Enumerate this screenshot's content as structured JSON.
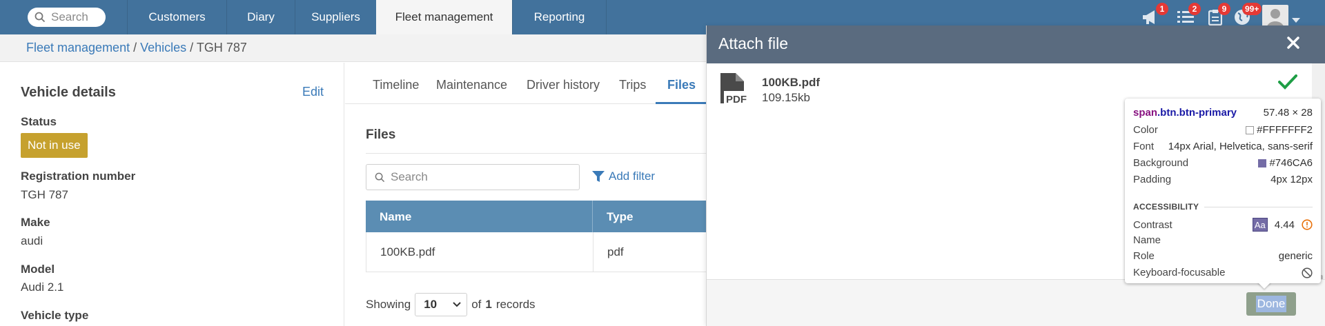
{
  "search": {
    "placeholder": "Search"
  },
  "nav": {
    "tabs": [
      {
        "label": "Customers"
      },
      {
        "label": "Diary"
      },
      {
        "label": "Suppliers"
      },
      {
        "label": "Fleet management"
      },
      {
        "label": "Reporting"
      }
    ],
    "active_tab": "Fleet management",
    "badges": {
      "announcements": "1",
      "tasks": "2",
      "clipboard": "9",
      "globe": "99+"
    }
  },
  "breadcrumb": {
    "level1": "Fleet management",
    "sep": " / ",
    "level2": "Vehicles",
    "current": "TGH 787"
  },
  "vehicle": {
    "title": "Vehicle details",
    "edit_label": "Edit",
    "status_label": "Status",
    "status_value": "Not in use",
    "reg_label": "Registration number",
    "reg_value": "TGH 787",
    "make_label": "Make",
    "make_value": "audi",
    "model_label": "Model",
    "model_value": "Audi 2.1",
    "type_label": "Vehicle type"
  },
  "tabs": [
    {
      "label": "Timeline"
    },
    {
      "label": "Maintenance"
    },
    {
      "label": "Driver history"
    },
    {
      "label": "Trips"
    },
    {
      "label": "Files"
    }
  ],
  "active_content_tab": "Files",
  "files": {
    "title": "Files",
    "search_placeholder": "Search",
    "add_filter": "Add filter",
    "columns": [
      "Name",
      "Type"
    ],
    "rows": [
      {
        "name": "100KB.pdf",
        "type": "pdf"
      }
    ],
    "showing_prefix": "Showing",
    "page_size": "10",
    "of_text": "of",
    "total": "1",
    "records_text": "records"
  },
  "modal": {
    "title": "Attach file",
    "file_name": "100KB.pdf",
    "file_size": "109.15kb",
    "file_icon_text": "PDF",
    "done_label": "Done"
  },
  "devtools_tooltip": {
    "selector_tag": "span",
    "selector_classes": ".btn.btn-primary",
    "size": "57.48 × 28",
    "color_label": "Color",
    "color_value": "#FFFFFFF2",
    "font_label": "Font",
    "font_value": "14px Arial, Helvetica, sans-serif",
    "background_label": "Background",
    "background_value": "#746CA6",
    "padding_label": "Padding",
    "padding_value": "4px 12px",
    "accessibility_heading": "ACCESSIBILITY",
    "contrast_label": "Contrast",
    "contrast_aa": "Aa",
    "contrast_value": "4.44",
    "name_label": "Name",
    "role_label": "Role",
    "role_value": "generic",
    "keyboard_label": "Keyboard-focusable"
  },
  "colors": {
    "nav": "#42729c",
    "accent": "#3a7ab8",
    "status": "#c6a12e",
    "table_header": "#5b8db3",
    "modal_header": "#5a6b7f",
    "badge": "#e53935"
  }
}
